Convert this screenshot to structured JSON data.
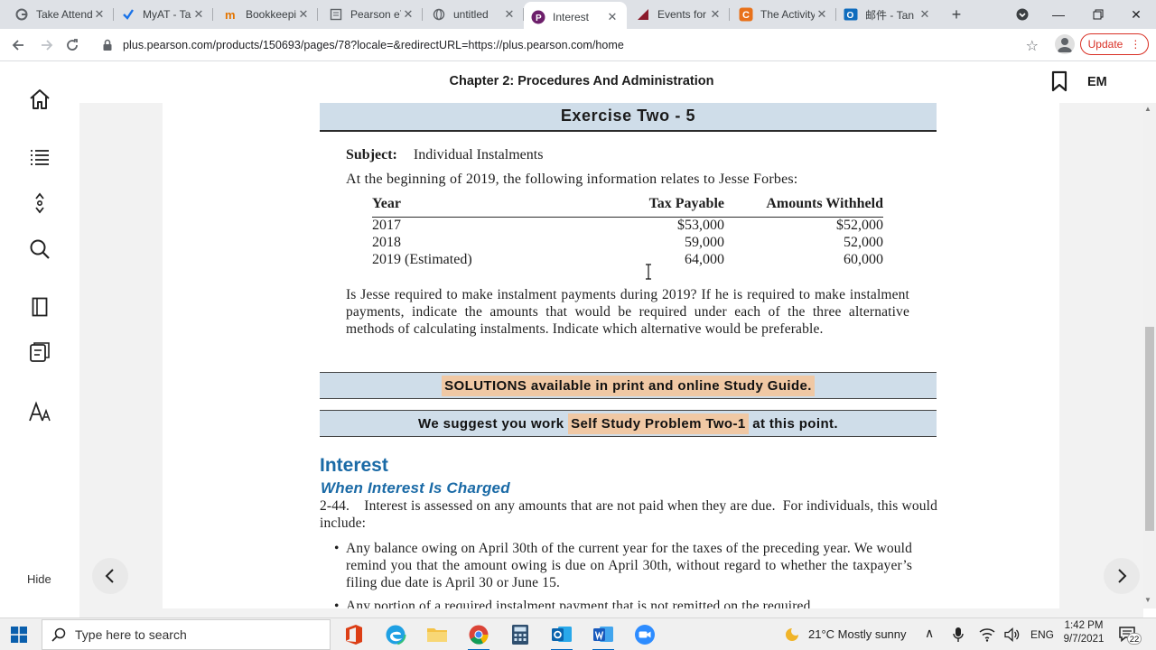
{
  "browser": {
    "tabs": [
      {
        "title": "Take Attend",
        "icon": "google-icon"
      },
      {
        "title": "MyAT - Talk",
        "icon": "checkmark-icon"
      },
      {
        "title": "Bookkeeping",
        "icon": "m-brand-icon"
      },
      {
        "title": "Pearson eTe",
        "icon": "doc-icon"
      },
      {
        "title": "untitled",
        "icon": "globe-icon"
      },
      {
        "title": "Interest",
        "icon": "pearson-icon",
        "active": true
      },
      {
        "title": "Events for",
        "icon": "slash-brand-icon"
      },
      {
        "title": "The Activity",
        "icon": "c-brand-icon"
      },
      {
        "title": "邮件 - Tan",
        "icon": "outlook-icon"
      }
    ],
    "url": "plus.pearson.com/products/150693/pages/78?locale=&redirectURL=https://plus.pearson.com/home",
    "update_label": "Update"
  },
  "header": {
    "chapter_title": "Chapter 2: Procedures And Administration",
    "user_initials": "EM"
  },
  "sidebar": {
    "items": [
      {
        "name": "home",
        "icon": "home-icon"
      },
      {
        "name": "contents",
        "icon": "list-icon"
      },
      {
        "name": "navigate",
        "icon": "expand-icon"
      },
      {
        "name": "search",
        "icon": "search-icon"
      },
      {
        "name": "notebook",
        "icon": "notebook-icon"
      },
      {
        "name": "study",
        "icon": "flashcard-icon"
      },
      {
        "name": "display",
        "icon": "text-size-icon"
      }
    ],
    "hide_label": "Hide"
  },
  "exercise": {
    "banner": "Exercise Two - 5",
    "subject_label": "Subject:",
    "subject_value": "Individual Instalments",
    "intro": "At the beginning of 2019, the following information relates to Jesse Forbes:",
    "table": {
      "headers": [
        "Year",
        "Tax Payable",
        "Amounts Withheld"
      ],
      "rows": [
        [
          "2017",
          "$53,000",
          "$52,000"
        ],
        [
          "2018",
          "59,000",
          "52,000"
        ],
        [
          "2019 (Estimated)",
          "64,000",
          "60,000"
        ]
      ]
    },
    "question": "Is Jesse required to make instalment payments during 2019? If he is required to make instalment payments, indicate the amounts that would be required under each of the three alternative methods of calculating instalments.  Indicate which alternative would be preferable."
  },
  "solutions_bar": {
    "highlight": "SOLUTIONS available in print and online Study Guide."
  },
  "suggest_bar": {
    "before": "We suggest you work ",
    "highlight": "Self Study Problem Two-1",
    "after": " at this point."
  },
  "section": {
    "title": "Interest",
    "subtitle": "When Interest Is Charged",
    "paragraph": "2-44.    Interest is assessed on any amounts that are not paid when they are due.  For individuals, this would include:",
    "bullets": [
      "Any balance owing on April 30th of the current year for the taxes of the preceding year.  We would remind you that the amount owing is due on April 30th, without regard to whether the taxpayer’s filing due date is April 30 or June 15.",
      "Any portion of a required instalment payment that is not remitted on the required"
    ]
  },
  "taskbar": {
    "search_placeholder": "Type here to search",
    "weather": "21°C  Mostly sunny",
    "language": "ENG",
    "time": "1:42 PM",
    "date": "9/7/2021",
    "notification_count": "22"
  },
  "colors": {
    "banner_bg": "#cfdde9",
    "highlight": "#f0c8a4",
    "heading_blue": "#1a6aa6",
    "update_red": "#d93025"
  }
}
